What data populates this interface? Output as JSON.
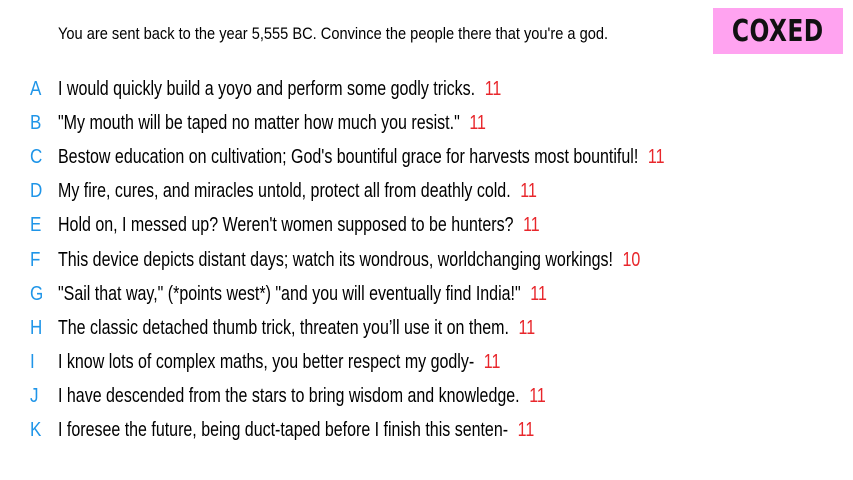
{
  "prompt": "You are sent back to the year 5,555 BC. Convince the people there that you're a god.",
  "brand": {
    "label": "COXED",
    "background": "#ffa3f0"
  },
  "colors": {
    "letter": "#1f95e8",
    "score": "#e8262b",
    "text": "#000000"
  },
  "answers": [
    {
      "letter": "A",
      "text": "I would quickly build a yoyo and perform some godly tricks.",
      "score": "11"
    },
    {
      "letter": "B",
      "text": "\"My mouth will be taped no matter how much you resist.\"",
      "score": "11"
    },
    {
      "letter": "C",
      "text": "Bestow education on cultivation; God's bountiful grace for harvests most bountiful!",
      "score": "11"
    },
    {
      "letter": "D",
      "text": "My fire, cures, and miracles untold, protect all from deathly cold.",
      "score": "11"
    },
    {
      "letter": "E",
      "text": "Hold on, I messed up? Weren't women supposed to be hunters?",
      "score": "11"
    },
    {
      "letter": "F",
      "text": "This device depicts distant days; watch its wondrous, worldchanging workings!",
      "score": "10"
    },
    {
      "letter": "G",
      "text": "\"Sail that way,\" (*points west*) \"and you will eventually find India!\"",
      "score": "11"
    },
    {
      "letter": "H",
      "text": "The classic detached thumb trick, threaten you’ll use it on them.",
      "score": "11"
    },
    {
      "letter": "I",
      "text": "I know lots of complex maths, you better respect my godly-",
      "score": "11"
    },
    {
      "letter": "J",
      "text": "I have descended from the stars to bring wisdom and knowledge.",
      "score": "11"
    },
    {
      "letter": "K",
      "text": "I foresee the future, being duct-taped before I finish this senten-",
      "score": "11"
    }
  ]
}
